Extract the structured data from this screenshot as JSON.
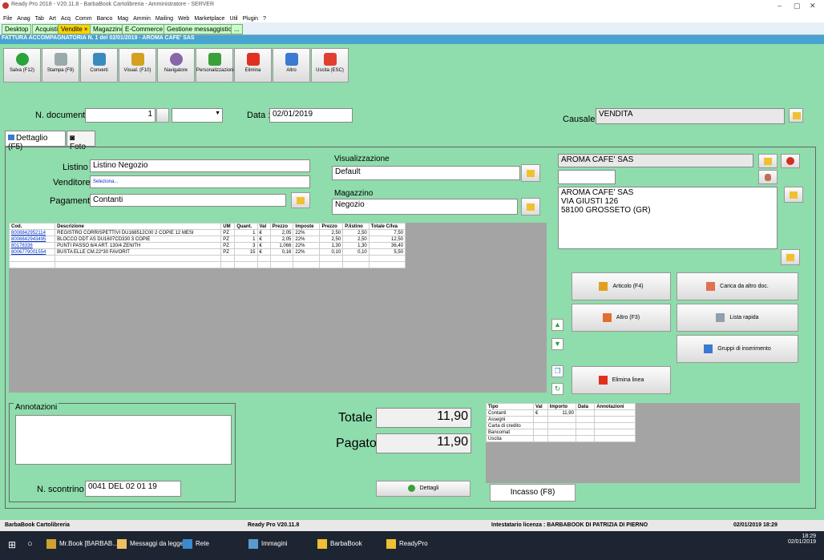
{
  "window": {
    "title": "Ready Pro 2018 - V20.11.8 - BarbaBook Cartolibreria - Amministratore - SERVER"
  },
  "menu": [
    "File",
    "Anag",
    "Tab",
    "Art",
    "Acq",
    "Comm",
    "Banco",
    "Mag",
    "Ammin",
    "Mailing",
    "Web",
    "Marketplace",
    "Util",
    "Plugin",
    "?"
  ],
  "tabs": [
    "Desktop",
    "Acquisti",
    "Vendite ×",
    "Magazzino",
    "E-Commerce",
    "Gestione messaggistica",
    "..."
  ],
  "doc_title": "FATTURA ACCOMPAGNATORIA N. 1 del 02/01/2019 - AROMA CAFE' SAS",
  "toolbar": [
    "Salva (F12)",
    "Stampa (F9)",
    "Converti",
    "Visual. (F10)",
    "Navigatore",
    "Personalizzazioni",
    "Elimina",
    "Altro",
    "Uscita (ESC)"
  ],
  "header": {
    "n_doc_label": "N. documento :",
    "n_doc_value": "1",
    "data_label": "Data :",
    "data_value": "02/01/2019",
    "causale_label": "Causale :",
    "causale_value": "VENDITA"
  },
  "subtabs": [
    "Dettaglio (F5)",
    "Foto"
  ],
  "form": {
    "listino_label": "Listino :",
    "listino_value": "Listino Negozio",
    "venditore_label": "Venditore :",
    "venditore_value": "Seleziona...",
    "pagamento_label": "Pagamento :",
    "pagamento_value": "Contanti",
    "visualizzazione_label": "Visualizzazione",
    "visualizzazione_value": "Default",
    "magazzino_label": "Magazzino",
    "magazzino_value": "Negozio"
  },
  "customer": {
    "name": "AROMA CAFE' SAS",
    "address": [
      "AROMA CAFE' SAS",
      "VIA GIUSTI 126",
      "58100 GROSSETO (GR)"
    ]
  },
  "table": {
    "headers": [
      "Cod.",
      "Descrizione",
      "UM",
      "Quant.",
      "Val",
      "Prezzo",
      "Imposte",
      "Prezzo",
      "P.listino",
      "Totale C/Iva"
    ],
    "rows": [
      [
        "8008842952114",
        "REGISTRO CORRISPETTIVI DU168512C00 2 COPIE 12 MESI",
        "PZ",
        "1",
        "€",
        "2,05",
        "22%",
        "2,50",
        "2,50",
        "7,50"
      ],
      [
        "8008842943495",
        "BLOCCO DDT AS DU1607CD330 3 COPIE",
        "PZ",
        "1",
        "€",
        "2,05",
        "22%",
        "2,50",
        "2,50",
        "12,50"
      ],
      [
        "80176336",
        "PUNTI PASSO 6/4 ART. 130/4 ZENITH",
        "PZ",
        "3",
        "€",
        "1,066",
        "22%",
        "1,30",
        "1,30",
        "36,40"
      ],
      [
        "8006779001554",
        "BUSTA ELLE CM.22*30 FAVORIT",
        "PZ",
        "15",
        "€",
        "0,16",
        "22%",
        "0,10",
        "0,10",
        "5,50"
      ]
    ]
  },
  "actions": {
    "articolo": "Articolo (F4)",
    "carica": "Carica da altro doc.",
    "altro": "Altro (F3)",
    "lista": "Lista rapida",
    "gruppi": "Gruppi di inserimento",
    "elimina_linea": "Elimina linea"
  },
  "annotazioni_label": "Annotazioni",
  "scontrino_label": "N. scontrino :",
  "scontrino_value": "0041 DEL 02 01 19",
  "totale_label": "Totale",
  "totale_value": "11,90",
  "pagato_label": "Pagato",
  "pagato_value": "11,90",
  "dettagli_label": "Dettagli",
  "payment_table": {
    "headers": [
      "Tipo",
      "Val",
      "Importo",
      "Data",
      "Annotazioni"
    ],
    "rows": [
      [
        "Contanti",
        "€",
        "11,90",
        "",
        ""
      ],
      [
        "Assegni",
        "",
        "",
        "",
        ""
      ],
      [
        "Carta di credito",
        "",
        "",
        "",
        ""
      ],
      [
        "Bancomat",
        "",
        "",
        "",
        ""
      ],
      [
        "Uscita",
        "",
        "",
        "",
        ""
      ]
    ]
  },
  "incasso_label": "Incasso (F8)",
  "status": {
    "left": "BarbaBook Cartolibreria",
    "center": "Ready Pro V20.11.8",
    "licenza": "Intestatario licenza : BARBABOOK DI PATRIZIA DI PIERNO",
    "datetime": "02/01/2019  18:29"
  },
  "taskbar": {
    "items": [
      "Mr.Book [BARBAB...",
      "Messaggi da legger...",
      "Rete",
      "Immagini",
      "BarbaBook",
      "ReadyPro"
    ],
    "time": "18:29",
    "date": "02/01/2019"
  }
}
